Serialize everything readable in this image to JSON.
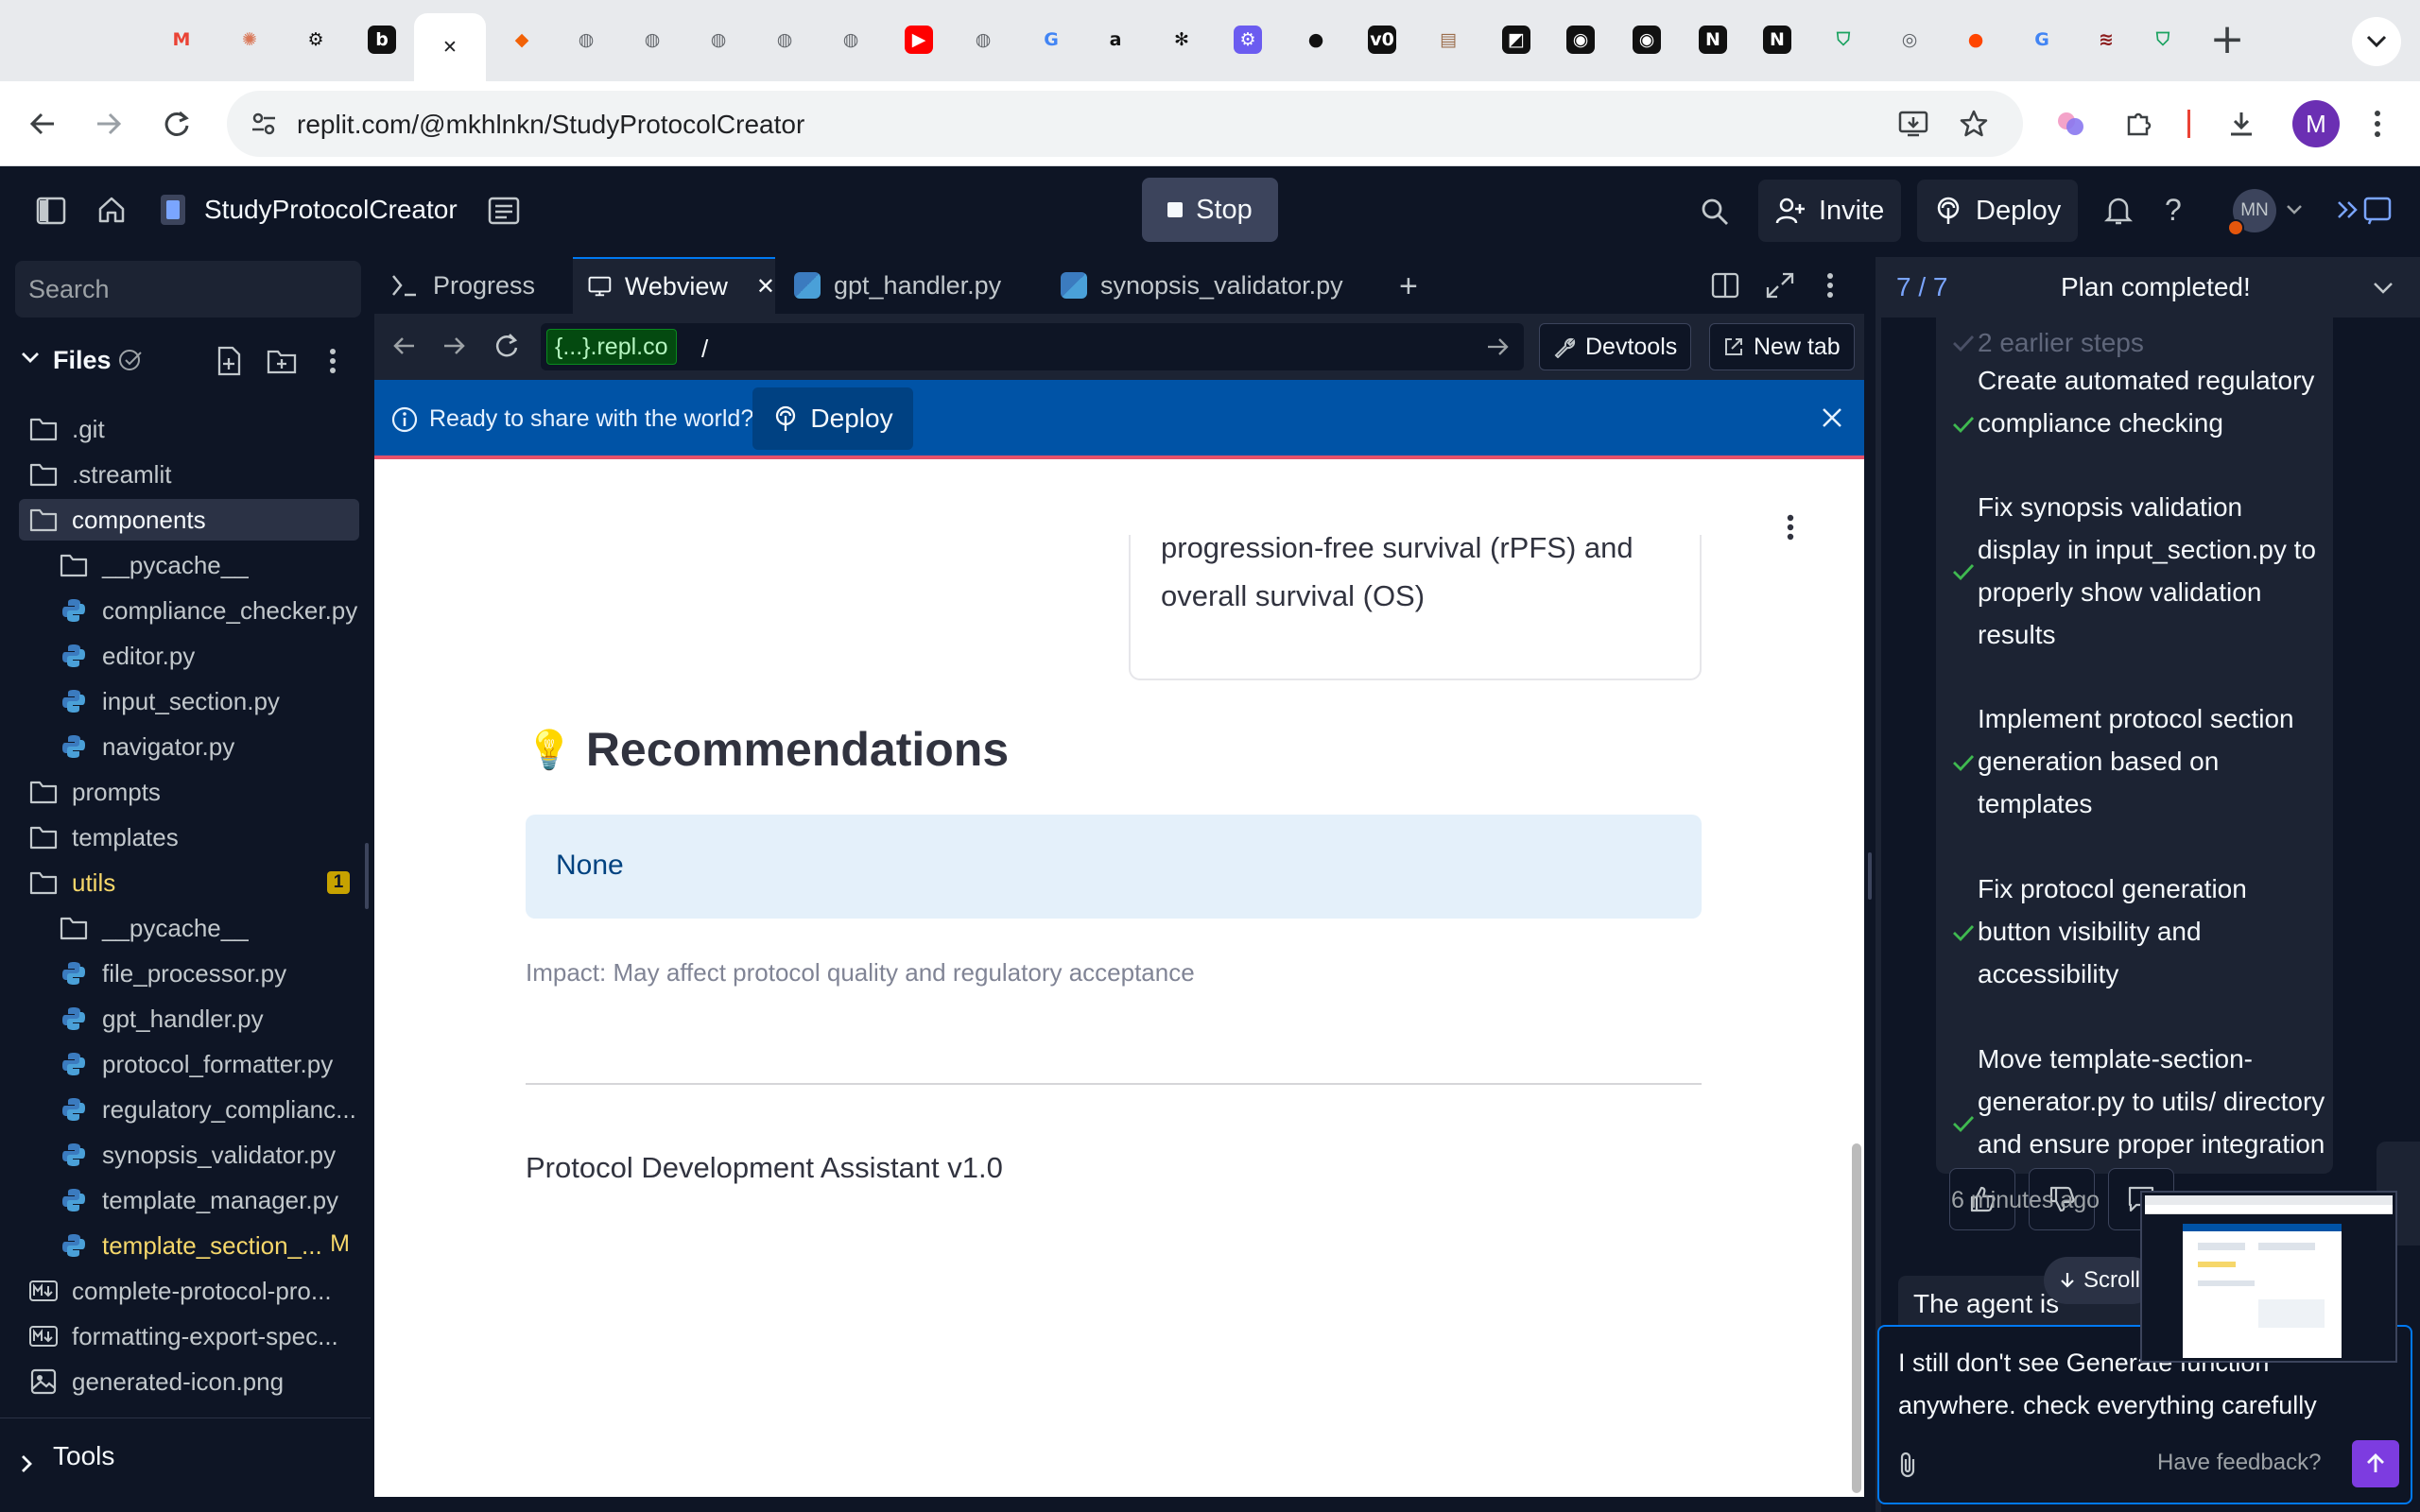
{
  "browser": {
    "tabs": [
      {
        "icon": "gmail-icon",
        "glyph": "M",
        "color": "#ea4335",
        "bg": "transparent"
      },
      {
        "icon": "claude-icon",
        "glyph": "✺",
        "color": "#d97757",
        "bg": "transparent"
      },
      {
        "icon": "chatgpt-icon",
        "glyph": "⚙",
        "color": "#111111",
        "bg": "transparent"
      },
      {
        "icon": "bolt-icon",
        "glyph": "b",
        "color": "#ffffff",
        "bg": "#111111"
      },
      {
        "icon": "close-icon",
        "glyph": "✕",
        "color": "#202124",
        "bg": "transparent"
      },
      {
        "icon": "replit-icon",
        "glyph": "◆",
        "color": "#f26207",
        "bg": "transparent"
      },
      {
        "icon": "globe-icon",
        "glyph": "◍",
        "color": "#5f6368",
        "bg": "transparent"
      },
      {
        "icon": "globe-icon",
        "glyph": "◍",
        "color": "#5f6368",
        "bg": "transparent"
      },
      {
        "icon": "globe-icon",
        "glyph": "◍",
        "color": "#5f6368",
        "bg": "transparent"
      },
      {
        "icon": "globe-icon",
        "glyph": "◍",
        "color": "#5f6368",
        "bg": "transparent"
      },
      {
        "icon": "globe-icon",
        "glyph": "◍",
        "color": "#5f6368",
        "bg": "transparent"
      },
      {
        "icon": "youtube-icon",
        "glyph": "▶",
        "color": "#ffffff",
        "bg": "#ff0000"
      },
      {
        "icon": "globe-icon",
        "glyph": "◍",
        "color": "#5f6368",
        "bg": "transparent"
      },
      {
        "icon": "google-icon",
        "glyph": "G",
        "color": "#4285f4",
        "bg": "transparent"
      },
      {
        "icon": "amazon-icon",
        "glyph": "a",
        "color": "#111111",
        "bg": "transparent"
      },
      {
        "icon": "perplexity-icon",
        "glyph": "✻",
        "color": "#111111",
        "bg": "transparent"
      },
      {
        "icon": "openai-icon",
        "glyph": "⚙",
        "color": "#ffffff",
        "bg": "#6b5cf0"
      },
      {
        "icon": "github-icon",
        "glyph": "●",
        "color": "#111111",
        "bg": "transparent"
      },
      {
        "icon": "v0-icon",
        "glyph": "v0",
        "color": "#ffffff",
        "bg": "#111111"
      },
      {
        "icon": "docker-icon",
        "glyph": "▤",
        "color": "#9a6c4a",
        "bg": "transparent"
      },
      {
        "icon": "cursor-icon",
        "glyph": "◩",
        "color": "#ffffff",
        "bg": "#111111"
      },
      {
        "icon": "podcast-icon",
        "glyph": "◉",
        "color": "#ffffff",
        "bg": "#111111"
      },
      {
        "icon": "podcast-icon",
        "glyph": "◉",
        "color": "#ffffff",
        "bg": "#111111"
      },
      {
        "icon": "notion-icon",
        "glyph": "N",
        "color": "#ffffff",
        "bg": "#111111"
      },
      {
        "icon": "notion-icon",
        "glyph": "N",
        "color": "#ffffff",
        "bg": "#111111"
      },
      {
        "icon": "shield-icon",
        "glyph": "⛉",
        "color": "#1aa260",
        "bg": "transparent"
      },
      {
        "icon": "chrome-icon",
        "glyph": "◎",
        "color": "#5f6368",
        "bg": "transparent"
      },
      {
        "icon": "reddit-icon",
        "glyph": "●",
        "color": "#ff4500",
        "bg": "transparent"
      },
      {
        "icon": "google-icon",
        "glyph": "G",
        "color": "#4285f4",
        "bg": "transparent"
      },
      {
        "icon": "brand-icon",
        "glyph": "≋",
        "color": "#8b1a1a",
        "bg": "transparent"
      },
      {
        "icon": "shield-icon",
        "glyph": "⛉",
        "color": "#1aa260",
        "bg": "transparent"
      }
    ],
    "url": "replit.com/@mkhlnkn/StudyProtocolCreator",
    "profile_initial": "M"
  },
  "replit": {
    "repl_name": "StudyProtocolCreator",
    "stop_label": "Stop",
    "invite_label": "Invite",
    "deploy_label": "Deploy",
    "user_initials": "MN"
  },
  "sidebar": {
    "search_placeholder": "Search",
    "files_label": "Files",
    "tools_label": "Tools",
    "tree": [
      {
        "label": ".git",
        "type": "folder",
        "indent": 0
      },
      {
        "label": ".streamlit",
        "type": "folder",
        "indent": 0
      },
      {
        "label": "components",
        "type": "folder",
        "indent": 0,
        "selected": true
      },
      {
        "label": "__pycache__",
        "type": "folder",
        "indent": 1
      },
      {
        "label": "compliance_checker.py",
        "type": "python",
        "indent": 1
      },
      {
        "label": "editor.py",
        "type": "python",
        "indent": 1
      },
      {
        "label": "input_section.py",
        "type": "python",
        "indent": 1
      },
      {
        "label": "navigator.py",
        "type": "python",
        "indent": 1
      },
      {
        "label": "prompts",
        "type": "folder",
        "indent": 0
      },
      {
        "label": "templates",
        "type": "folder",
        "indent": 0
      },
      {
        "label": "utils",
        "type": "folder",
        "indent": 0,
        "modified": true,
        "badge": "1"
      },
      {
        "label": "__pycache__",
        "type": "folder",
        "indent": 1
      },
      {
        "label": "file_processor.py",
        "type": "python",
        "indent": 1
      },
      {
        "label": "gpt_handler.py",
        "type": "python",
        "indent": 1
      },
      {
        "label": "protocol_formatter.py",
        "type": "python",
        "indent": 1
      },
      {
        "label": "regulatory_complianc...",
        "type": "python",
        "indent": 1
      },
      {
        "label": "synopsis_validator.py",
        "type": "python",
        "indent": 1
      },
      {
        "label": "template_manager.py",
        "type": "python",
        "indent": 1
      },
      {
        "label": "template_section_...",
        "type": "python",
        "indent": 1,
        "modified": true,
        "badge": "M"
      },
      {
        "label": "complete-protocol-pro...",
        "type": "markdown",
        "indent": 0
      },
      {
        "label": "formatting-export-spec...",
        "type": "markdown",
        "indent": 0
      },
      {
        "label": "generated-icon.png",
        "type": "image",
        "indent": 0
      }
    ]
  },
  "editor_tabs": {
    "tabs": [
      {
        "label": "Progress",
        "icon": "progress-icon"
      },
      {
        "label": "Webview",
        "icon": "monitor-icon",
        "active": true
      },
      {
        "label": "gpt_handler.py",
        "icon": "python-icon"
      },
      {
        "label": "synopsis_validator.py",
        "icon": "python-icon"
      }
    ]
  },
  "webview_bar": {
    "domain_chip": "{...}.repl.co",
    "path": "/",
    "devtools_label": "Devtools",
    "newtab_label": "New tab"
  },
  "banner": {
    "text": "Ready to share with the world?",
    "deploy_label": "Deploy"
  },
  "page": {
    "outcome_text": "progression-free survival (rPFS) and overall survival (OS)",
    "recommendations_heading": "Recommendations",
    "recommendations_emoji": "💡",
    "recommendation_value": "None",
    "impact": "Impact: May affect protocol quality and regulatory acceptance",
    "footer": "Protocol Development Assistant v1.0"
  },
  "agent": {
    "progress": "7 / 7",
    "status": "Plan completed!",
    "earlier_steps": "2 earlier steps",
    "steps": [
      "Create automated regulatory compliance checking",
      "Fix synopsis validation display in input_section.py to properly show validation results",
      "Implement protocol section generation based on templates",
      "Fix protocol generation button visibility and accessibility",
      "Move template-section-generator.py to utils/ directory and ensure proper integration"
    ],
    "time_ago": "6 minutes ago",
    "agent_status": "The agent is",
    "scroll_label": "Scroll",
    "chat_input": "I still don't see Generate function anywhere. check everything carefully",
    "feedback_label": "Have feedback?"
  }
}
